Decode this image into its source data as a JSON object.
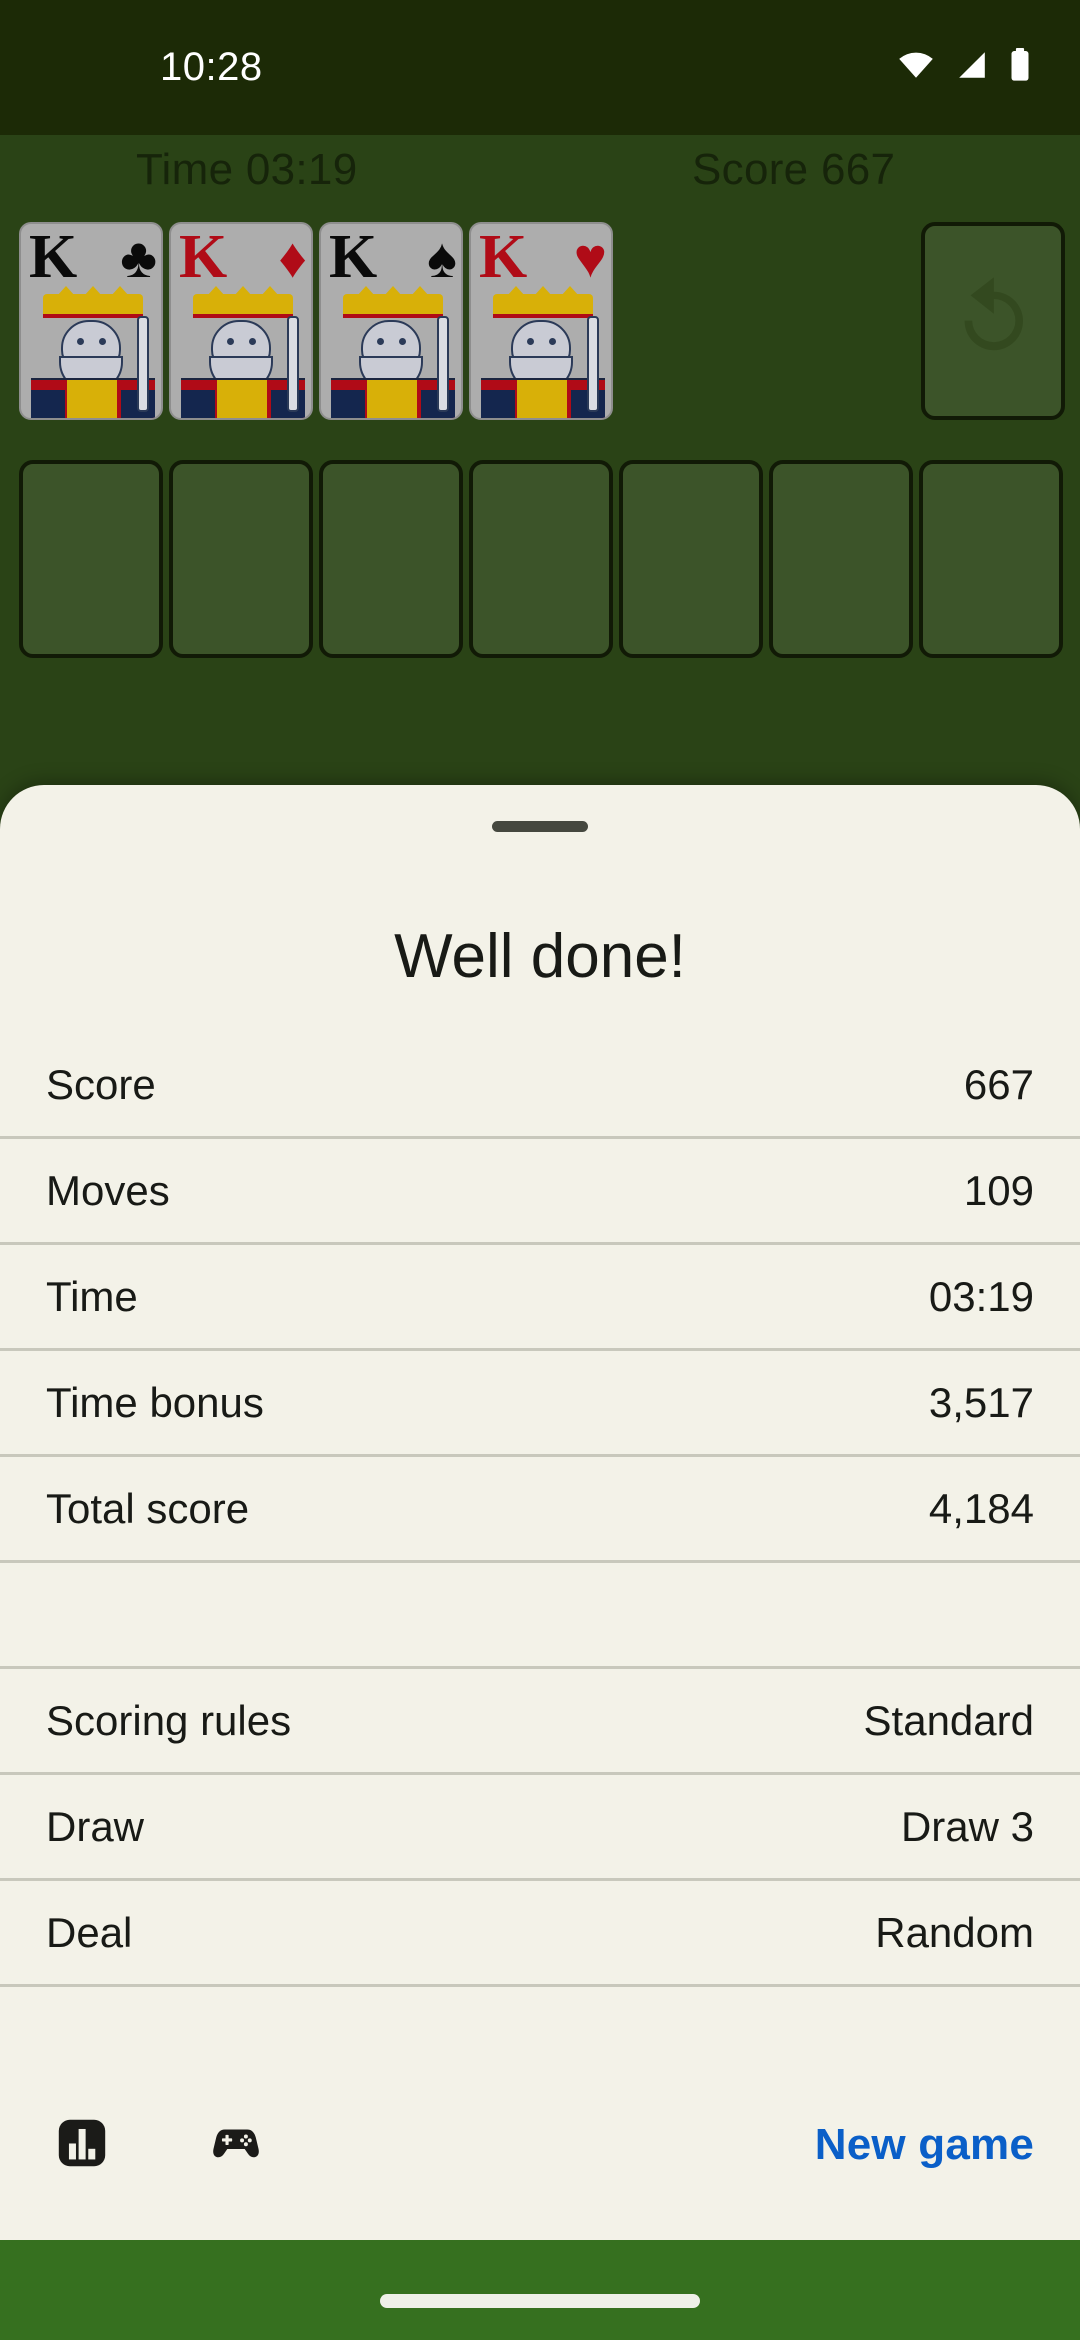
{
  "status_bar": {
    "clock": "10:28",
    "icons": [
      "wifi-icon",
      "cellular-signal-icon",
      "battery-icon"
    ]
  },
  "game": {
    "header": {
      "time_label": "Time 03:19",
      "score_label": "Score 667"
    },
    "foundations": [
      {
        "rank": "K",
        "suit": "clubs",
        "pip": "♣",
        "color": "black"
      },
      {
        "rank": "K",
        "suit": "diamonds",
        "pip": "♦",
        "color": "red"
      },
      {
        "rank": "K",
        "suit": "spades",
        "pip": "♠",
        "color": "black"
      },
      {
        "rank": "K",
        "suit": "hearts",
        "pip": "♥",
        "color": "red"
      }
    ],
    "undo_icon": "undo-icon",
    "tableau_empty_slots": 7,
    "table_color": "#2A4316",
    "slot_color": "#3C5429"
  },
  "sheet": {
    "title": "Well done!",
    "rows": [
      {
        "label": "Score",
        "value": "667"
      },
      {
        "label": "Moves",
        "value": "109"
      },
      {
        "label": "Time",
        "value": "03:19"
      },
      {
        "label": "Time bonus",
        "value": "3,517"
      },
      {
        "label": "Total score",
        "value": "4,184"
      },
      {
        "label": "",
        "value": ""
      },
      {
        "label": "Scoring rules",
        "value": "Standard"
      },
      {
        "label": "Draw",
        "value": "Draw 3"
      },
      {
        "label": "Deal",
        "value": "Random"
      }
    ],
    "actions": {
      "stats_icon": "bar-chart-icon",
      "gamepad_icon": "gamepad-icon",
      "new_game_label": "New game",
      "new_game_color": "#0A5FC8"
    }
  }
}
